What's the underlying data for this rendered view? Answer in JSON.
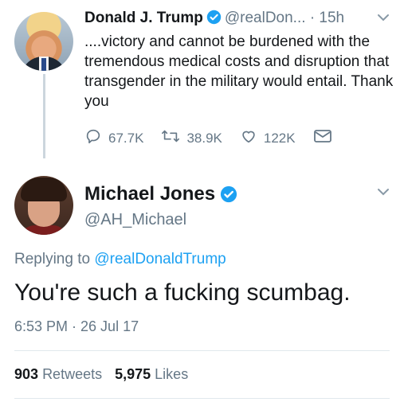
{
  "parent_tweet": {
    "author_name": "Donald J. Trump",
    "handle": "@realDon...",
    "time_sep": "·",
    "time": "15h",
    "text": "....victory and cannot be burdened with the tremendous medical costs and disruption that transgender in the military would entail. Thank you",
    "actions": {
      "replies": "67.7K",
      "retweets": "38.9K",
      "likes": "122K"
    }
  },
  "reply_tweet": {
    "author_name": "Michael Jones",
    "handle": "@AH_Michael",
    "replying_prefix": "Replying to",
    "replying_handle": "@realDonaldTrump",
    "text": "You're such a fucking scumbag.",
    "timestamp": "6:53 PM · 26 Jul 17",
    "stats": {
      "retweets_count": "903",
      "retweets_label": "Retweets",
      "likes_count": "5,975",
      "likes_label": "Likes"
    }
  },
  "colors": {
    "verified": "#1da1f2",
    "link": "#1da1f2",
    "secondary_text": "#657786",
    "divider": "#e1e8ed"
  },
  "icons": [
    "verified-badge-icon",
    "chevron-down-icon",
    "reply-icon",
    "retweet-icon",
    "like-icon",
    "direct-message-icon"
  ]
}
